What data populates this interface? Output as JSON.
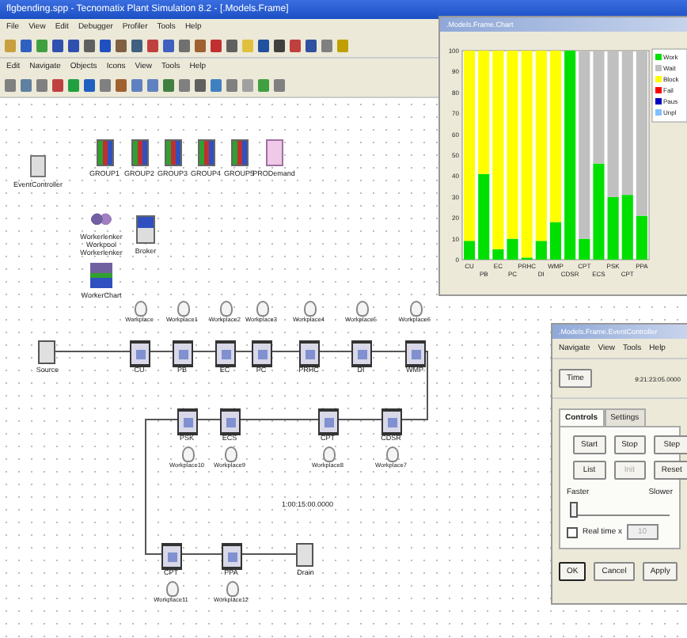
{
  "window": {
    "title": "flgbending.spp - Tecnomatix Plant Simulation 8.2 - [.Models.Frame]"
  },
  "menu": [
    "File",
    "View",
    "Edit",
    "Debugger",
    "Profiler",
    "Tools",
    "Help"
  ],
  "sub_menu": [
    "Edit",
    "Navigate",
    "Objects",
    "Icons",
    "View",
    "Tools",
    "Help"
  ],
  "objects": [
    {
      "kind": "control",
      "labels": [
        "EventController"
      ]
    },
    {
      "kind": "group",
      "labels": [
        "GROUP1"
      ]
    },
    {
      "kind": "group",
      "labels": [
        "GROUP2"
      ]
    },
    {
      "kind": "group",
      "labels": [
        "GROUP3"
      ]
    },
    {
      "kind": "group",
      "labels": [
        "GROUP4"
      ]
    },
    {
      "kind": "group",
      "labels": [
        "GROUP5"
      ]
    },
    {
      "kind": "table",
      "labels": [
        "PRODemand"
      ]
    },
    {
      "kind": "pool",
      "labels": [
        "Workerlenker",
        "Workpool",
        "Workerlenker"
      ]
    },
    {
      "kind": "broker",
      "labels": [
        "Broker"
      ]
    },
    {
      "kind": "workerchart",
      "labels": [
        "WorkerChart"
      ]
    }
  ],
  "stations": [
    {
      "kind": "source",
      "label": "Source"
    },
    {
      "kind": "station",
      "label": "CU",
      "worker": "Workplace"
    },
    {
      "kind": "station",
      "label": "PB",
      "worker": "Workplace1"
    },
    {
      "kind": "station",
      "label": "EC",
      "worker": "Workplace2"
    },
    {
      "kind": "station",
      "label": "PC",
      "worker": "Workplace3"
    },
    {
      "kind": "station",
      "label": "PRHC",
      "worker": "Workplace4"
    },
    {
      "kind": "station",
      "label": "DI",
      "worker": "Workplace5"
    },
    {
      "kind": "station",
      "label": "WMP",
      "worker": "Workplace6"
    },
    {
      "kind": "station",
      "label": "PSK",
      "worker": "Workplace10"
    },
    {
      "kind": "station",
      "label": "ECS",
      "worker": "Workplace9"
    },
    {
      "kind": "station",
      "label": "CPT",
      "worker": "Workplace8"
    },
    {
      "kind": "station",
      "label": "CDSR",
      "worker": "Workplace7"
    },
    {
      "kind": "station",
      "label": "CPT",
      "worker": "Workplace11"
    },
    {
      "kind": "station",
      "label": "PPA",
      "worker": "Workplace12"
    },
    {
      "kind": "drain",
      "label": "Drain"
    }
  ],
  "sim_time": "1:00:15:00.0000",
  "chart_window": {
    "title": ".Models.Frame.Chart",
    "chart_data": {
      "type": "bar",
      "stacked": true,
      "categories": [
        "CU",
        "PB",
        "EC",
        "PC",
        "PRHC",
        "DI",
        "WMP",
        "CDSR",
        "CPT",
        "ECS",
        "PSK",
        "CPT",
        "PPA"
      ],
      "series": [
        {
          "name": "Work",
          "color": "#00e000",
          "values": [
            9,
            41,
            5,
            10,
            1,
            9,
            18,
            100,
            10,
            46,
            30,
            31,
            21
          ]
        },
        {
          "name": "Wait",
          "color": "#c0c0c0",
          "values": [
            0,
            0,
            0,
            0,
            0,
            0,
            0,
            0,
            90,
            54,
            70,
            69,
            79
          ]
        },
        {
          "name": "Block",
          "color": "#ffff00",
          "values": [
            91,
            59,
            95,
            90,
            99,
            91,
            82,
            0,
            0,
            0,
            0,
            0,
            0
          ]
        },
        {
          "name": "Fail",
          "color": "#ff0000",
          "values": [
            0,
            0,
            0,
            0,
            0,
            0,
            0,
            0,
            0,
            0,
            0,
            0,
            0
          ]
        },
        {
          "name": "Paus",
          "color": "#0000c0",
          "values": [
            0,
            0,
            0,
            0,
            0,
            0,
            0,
            0,
            0,
            0,
            0,
            0,
            0
          ]
        },
        {
          "name": "Unpl",
          "color": "#80c0ff",
          "values": [
            0,
            0,
            0,
            0,
            0,
            0,
            0,
            0,
            0,
            0,
            0,
            0,
            0
          ]
        }
      ],
      "legend": true,
      "ylim": [
        0,
        100
      ],
      "yticks": [
        0,
        10,
        20,
        30,
        40,
        50,
        60,
        70,
        80,
        90,
        100
      ]
    }
  },
  "event_controller": {
    "title": ".Models.Frame.EventController",
    "menu": [
      "Navigate",
      "View",
      "Tools",
      "Help"
    ],
    "time_button": "Time",
    "time": "9:21:23:05.0000",
    "tabs": [
      {
        "label": "Controls",
        "selected": true
      },
      {
        "label": "Settings",
        "selected": false
      }
    ],
    "buttons": [
      {
        "label": "Start",
        "disabled": false
      },
      {
        "label": "Stop",
        "disabled": false
      },
      {
        "label": "Step",
        "disabled": false
      },
      {
        "label": "List",
        "disabled": false
      },
      {
        "label": "Init",
        "disabled": true
      },
      {
        "label": "Reset",
        "disabled": false
      }
    ],
    "faster": "Faster",
    "slower": "Slower",
    "speed": {
      "level": 0
    },
    "real_time": {
      "label": "Real time x",
      "checked": false,
      "value": "10",
      "disabled": true
    },
    "footer": [
      "OK",
      "Cancel",
      "Apply"
    ]
  }
}
